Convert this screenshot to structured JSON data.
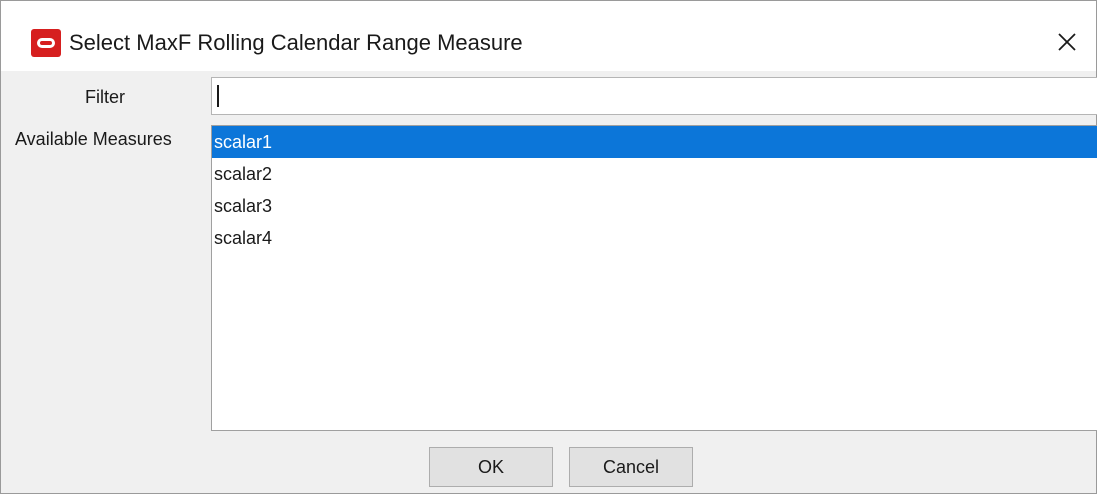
{
  "dialog": {
    "title": "Select MaxF Rolling Calendar Range Measure",
    "icons": {
      "app": "oracle-logo-icon",
      "close": "close-icon"
    },
    "accent_color": "#0c76d9",
    "brand_color": "#d61f1f"
  },
  "filter": {
    "label": "Filter",
    "value": ""
  },
  "measures": {
    "label": "Available Measures",
    "items": [
      {
        "label": "scalar1",
        "selected": true
      },
      {
        "label": "scalar2",
        "selected": false
      },
      {
        "label": "scalar3",
        "selected": false
      },
      {
        "label": "scalar4",
        "selected": false
      }
    ]
  },
  "buttons": {
    "ok": "OK",
    "cancel": "Cancel"
  }
}
